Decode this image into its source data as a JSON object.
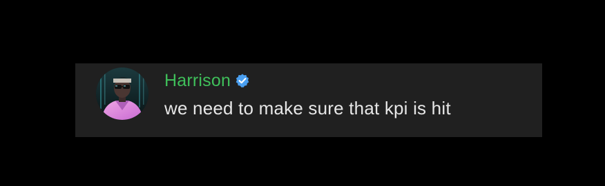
{
  "message": {
    "author": {
      "name": "Harrison",
      "name_color": "#3fbf5a",
      "verified": true,
      "verified_icon": "verified-badge-icon",
      "verified_color": "#4a9ff0",
      "avatar": "avatar-portrait"
    },
    "text": "we need to make sure that kpi is hit"
  },
  "colors": {
    "page_background": "#000000",
    "card_background": "#202020",
    "text": "#e6e6e6"
  }
}
